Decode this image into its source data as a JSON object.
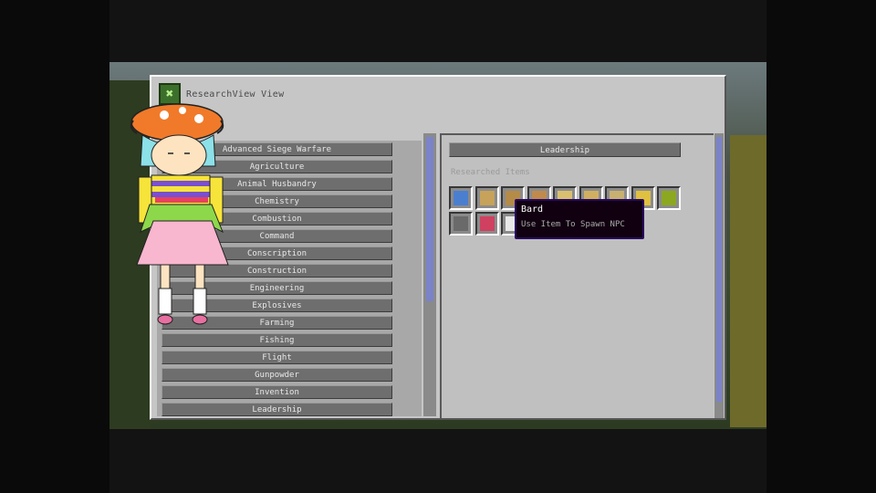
{
  "window": {
    "title": "ResearchView View"
  },
  "categories": [
    {
      "label": "Advanced Siege Warfare"
    },
    {
      "label": "Agriculture"
    },
    {
      "label": "Animal Husbandry"
    },
    {
      "label": "Chemistry"
    },
    {
      "label": "Combustion"
    },
    {
      "label": "Command"
    },
    {
      "label": "Conscription"
    },
    {
      "label": "Construction"
    },
    {
      "label": "Engineering"
    },
    {
      "label": "Explosives"
    },
    {
      "label": "Farming"
    },
    {
      "label": "Fishing"
    },
    {
      "label": "Flight"
    },
    {
      "label": "Gunpowder"
    },
    {
      "label": "Invention"
    },
    {
      "label": "Leadership"
    }
  ],
  "detail": {
    "section_title": "Leadership",
    "researched_label": "Researched Items",
    "items_row1": [
      {
        "icon": "npc-spawner-icon",
        "color": "#4a7fd0"
      },
      {
        "icon": "scroll-icon",
        "color": "#c7a25a"
      },
      {
        "icon": "scroll-icon",
        "color": "#b58b48"
      },
      {
        "icon": "scroll-icon",
        "color": "#c08a4c"
      },
      {
        "icon": "staff-icon",
        "color": "#d8c070"
      },
      {
        "icon": "banner-icon",
        "color": "#d0b060"
      },
      {
        "icon": "banner-icon",
        "color": "#c8b070"
      },
      {
        "icon": "horn-icon",
        "color": "#e0c040"
      },
      {
        "icon": "block-icon",
        "color": "#8ca820"
      }
    ],
    "items_row2": [
      {
        "icon": "pickaxe-icon",
        "color": "#6a6a6a"
      },
      {
        "icon": "potion-icon",
        "color": "#d04060"
      },
      {
        "icon": "book-icon",
        "color": "#e8e8e8"
      }
    ]
  },
  "tooltip": {
    "title": "Bard",
    "description": "Use Item To Spawn NPC"
  }
}
